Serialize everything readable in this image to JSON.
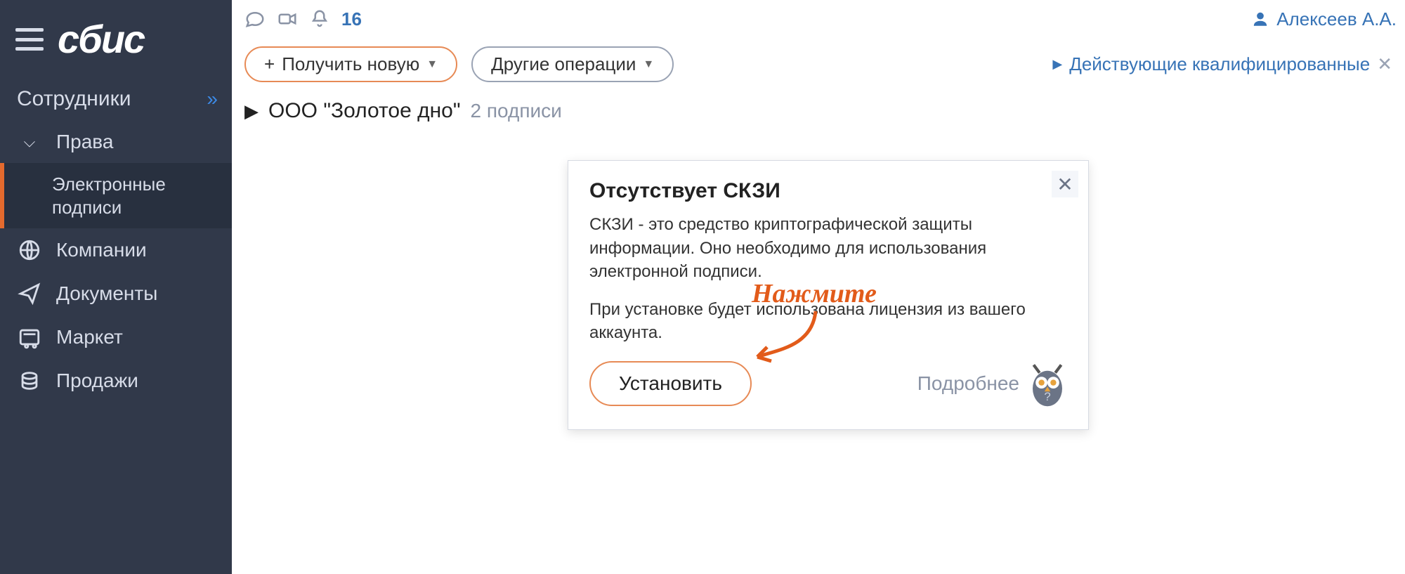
{
  "app": {
    "logo": "сбис"
  },
  "sidebar": {
    "section_title": "Сотрудники",
    "items": [
      {
        "label": "Права"
      },
      {
        "label": "Электронные подписи"
      },
      {
        "label": "Компании"
      },
      {
        "label": "Документы"
      },
      {
        "label": "Маркет"
      },
      {
        "label": "Продажи"
      }
    ]
  },
  "topbar": {
    "notification_count": "16",
    "user_name": "Алексеев А.А."
  },
  "toolbar": {
    "get_new_label": "Получить новую",
    "other_ops_label": "Другие операции",
    "filter_label": "Действующие квалифицированные"
  },
  "org": {
    "name": "ООО \"Золотое дно\"",
    "count_text": "2 подписи"
  },
  "dialog": {
    "title": "Отсутствует СКЗИ",
    "p1": "СКЗИ - это средство криптографической защиты информации. Оно необходимо для использования электронной подписи.",
    "p2": "При установке будет использована лицензия из вашего аккаунта.",
    "install_label": "Установить",
    "more_label": "Подробнее"
  },
  "annotation": {
    "text": "Нажмите"
  }
}
